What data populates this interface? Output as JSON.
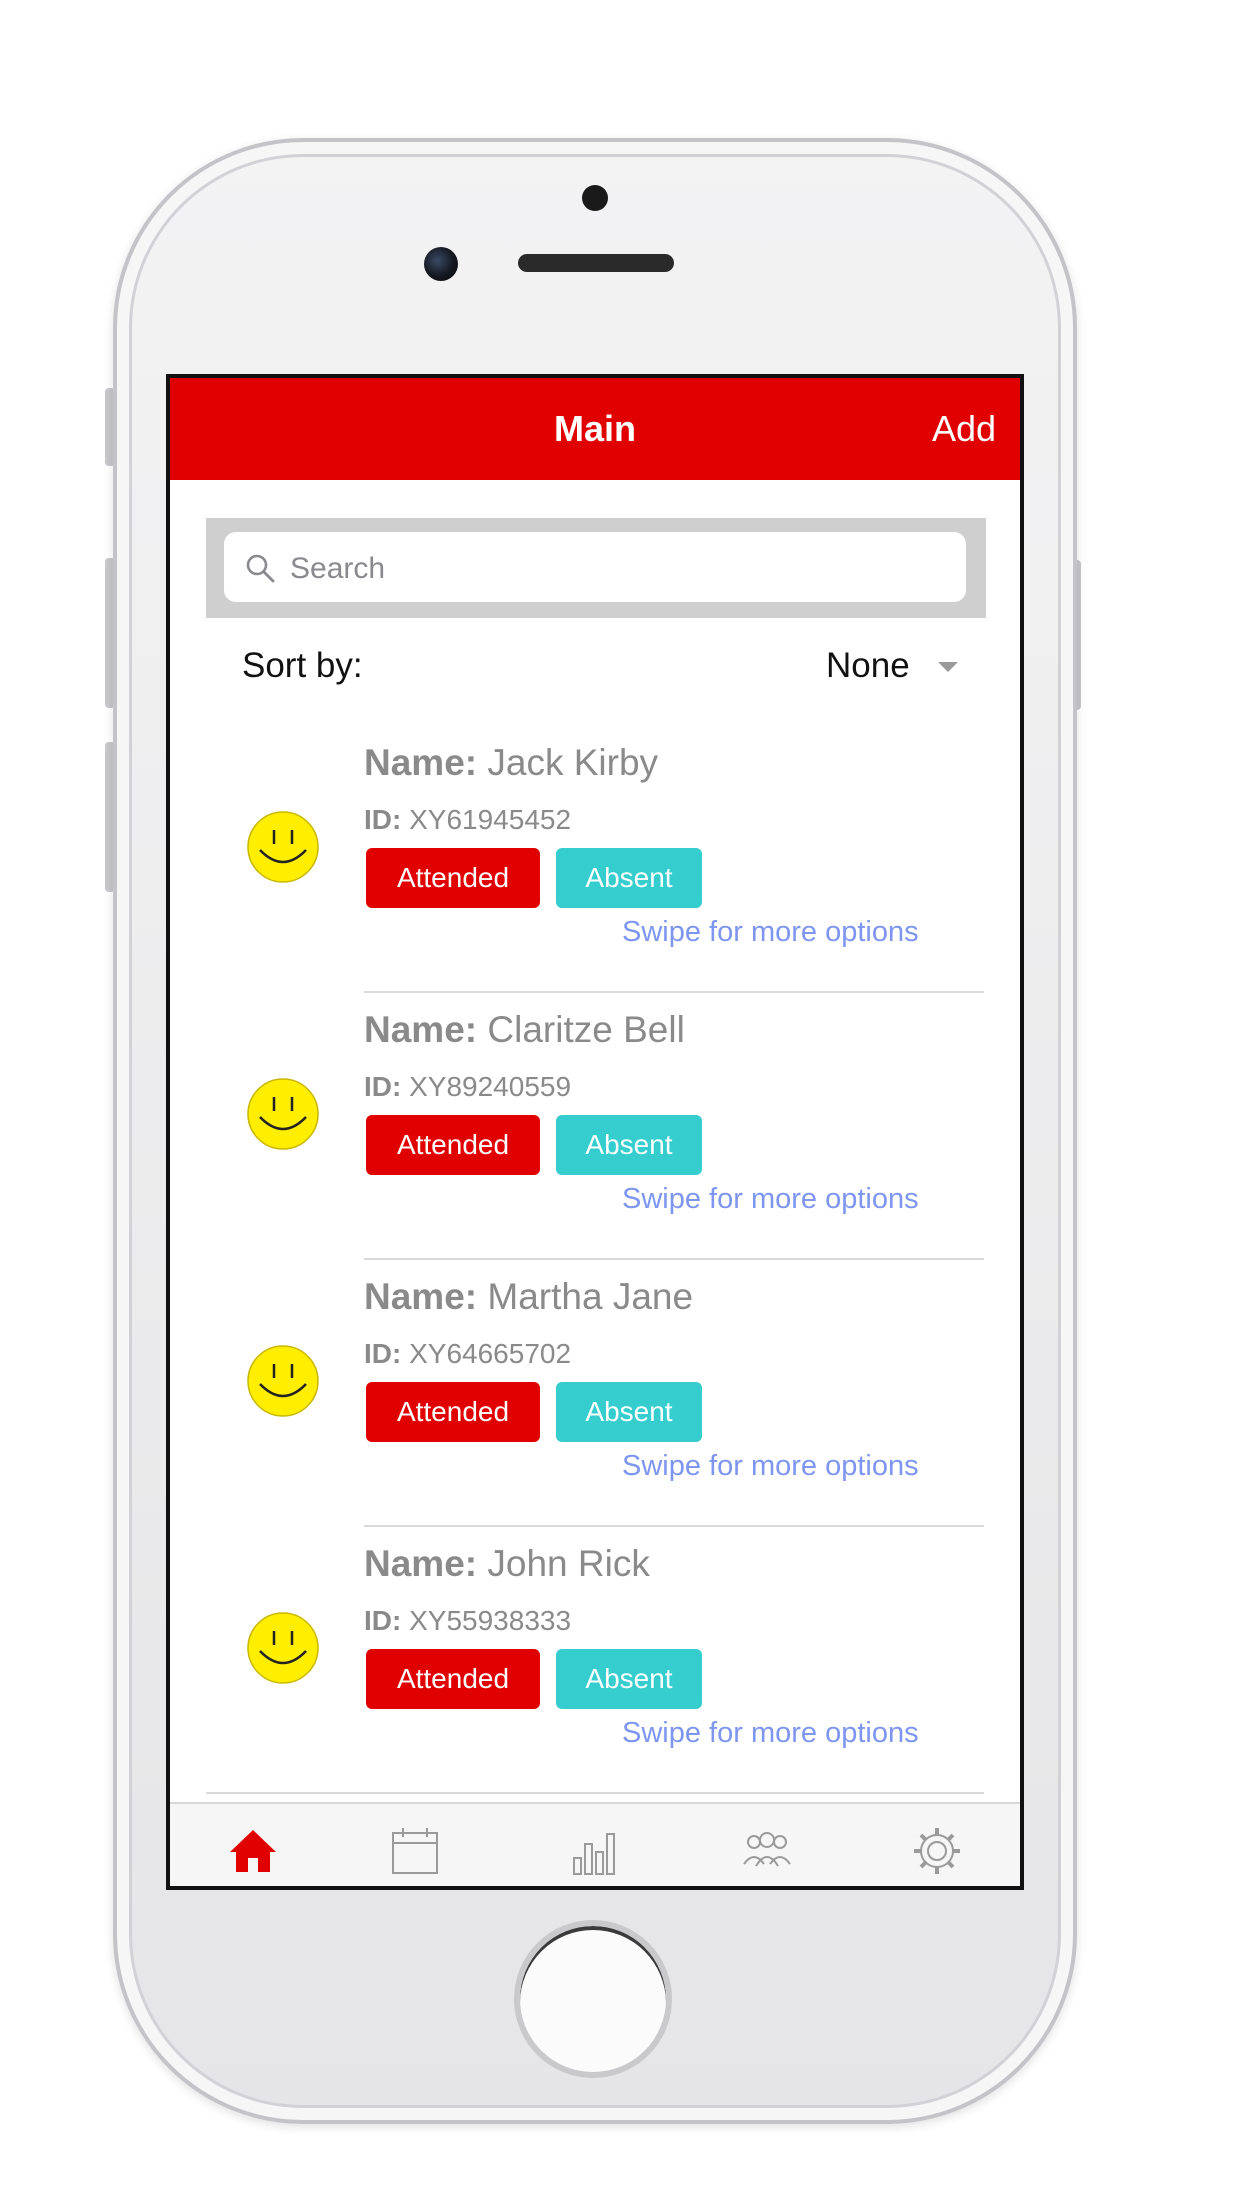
{
  "navbar": {
    "title": "Main",
    "add_label": "Add"
  },
  "search": {
    "placeholder": "Search"
  },
  "sort": {
    "label": "Sort by:",
    "value": "None"
  },
  "people": [
    {
      "name_key": "Name:",
      "name": "Jack Kirby",
      "id_key": "ID:",
      "id": "XY61945452",
      "attended_label": "Attended",
      "absent_label": "Absent",
      "swipe_hint": "Swipe for more options"
    },
    {
      "name_key": "Name:",
      "name": "Claritze Bell",
      "id_key": "ID:",
      "id": "XY89240559",
      "attended_label": "Attended",
      "absent_label": "Absent",
      "swipe_hint": "Swipe for more options"
    },
    {
      "name_key": "Name:",
      "name": "Martha Jane",
      "id_key": "ID:",
      "id": "XY64665702",
      "attended_label": "Attended",
      "absent_label": "Absent",
      "swipe_hint": "Swipe for more options"
    },
    {
      "name_key": "Name:",
      "name": "John Rick",
      "id_key": "ID:",
      "id": "XY55938333",
      "attended_label": "Attended",
      "absent_label": "Absent",
      "swipe_hint": "Swipe for more options"
    }
  ],
  "tabbar": {
    "items": [
      {
        "icon": "home-icon",
        "active": true
      },
      {
        "icon": "calendar-icon",
        "active": false
      },
      {
        "icon": "bar-chart-icon",
        "active": false
      },
      {
        "icon": "group-icon",
        "active": false
      },
      {
        "icon": "gear-icon",
        "active": false
      }
    ]
  },
  "colors": {
    "brand_red": "#e00000",
    "absent_teal": "#35cdcd",
    "link_blue": "#7e96f0",
    "avatar_yellow": "#ffee00"
  }
}
